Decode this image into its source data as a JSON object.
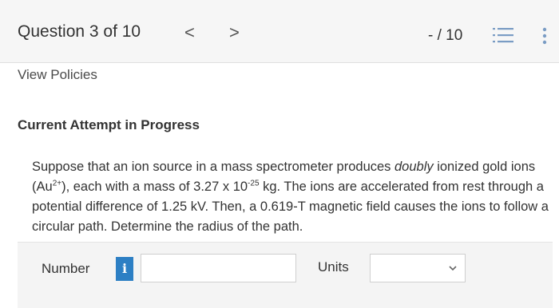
{
  "header": {
    "question_title": "Question 3 of 10",
    "prev_glyph": "<",
    "next_glyph": ">",
    "score": "- / 10",
    "list_icon": "list-icon",
    "more_icon": "more-vertical-icon"
  },
  "policies_link": "View Policies",
  "attempt_heading": "Current Attempt in Progress",
  "question": {
    "p1": "Suppose that an ion source in a mass spectrometer produces ",
    "emph": "doubly",
    "p2": " ionized gold ions (Au",
    "charge": "2+",
    "p3": "), each with a mass of 3.27 x 10",
    "exponent": "-25",
    "p4": " kg. The ions are accelerated from rest through a potential difference of 1.25 kV. Then, a 0.619-T magnetic field causes the ions to follow a circular path. Determine the radius of the path."
  },
  "answer": {
    "number_label": "Number",
    "info_glyph": "i",
    "number_value": "",
    "units_label": "Units",
    "units_value": ""
  },
  "colors": {
    "accent": "#2d7fc4",
    "header_bg": "#f6f6f6",
    "answer_bg": "#f4f4f4"
  }
}
